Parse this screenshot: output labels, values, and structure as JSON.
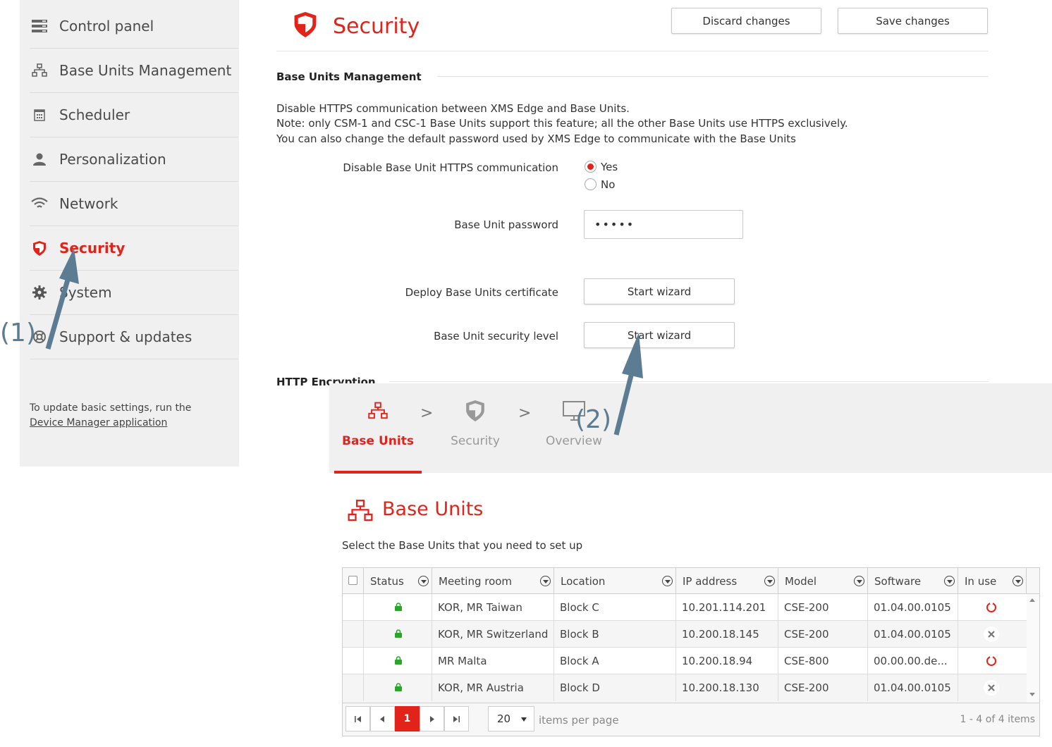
{
  "sidebar": {
    "items": [
      {
        "label": "Control panel",
        "icon": "control-panel-icon"
      },
      {
        "label": "Base Units Management",
        "icon": "network-icon"
      },
      {
        "label": "Scheduler",
        "icon": "calendar-icon"
      },
      {
        "label": "Personalization",
        "icon": "user-icon"
      },
      {
        "label": "Network",
        "icon": "wifi-icon"
      },
      {
        "label": "Security",
        "icon": "shield-icon",
        "active": true
      },
      {
        "label": "System",
        "icon": "gear-icon"
      },
      {
        "label": "Support & updates",
        "icon": "lifebuoy-icon"
      }
    ],
    "note_text": "To update basic settings, run the",
    "note_link": "Device Manager application"
  },
  "header": {
    "title": "Security",
    "discard_label": "Discard changes",
    "save_label": "Save changes"
  },
  "base_units_section": {
    "title": "Base Units Management",
    "desc_lines": [
      "Disable HTTPS communication between XMS Edge and Base Units.",
      "Note: only CSM-1 and CSC-1 Base Units support this feature; all the other Base Units use HTTPS exclusively.",
      "You can also change the default password used by XMS Edge to communicate with the Base Units"
    ],
    "https_label": "Disable Base Unit HTTPS communication",
    "yes_label": "Yes",
    "no_label": "No",
    "password_label": "Base Unit password",
    "password_value": "•••••",
    "deploy_label": "Deploy Base Units certificate",
    "deploy_button": "Start wizard",
    "security_level_label": "Base Unit security level",
    "security_level_button": "Start wizard"
  },
  "http_section": {
    "title": "HTTP Encryption"
  },
  "wizard": {
    "steps": [
      {
        "label": "Base Units",
        "icon": "network-icon",
        "active": true
      },
      {
        "label": "Security",
        "icon": "shield-icon"
      },
      {
        "label": "Overview",
        "icon": "monitor-icon"
      }
    ],
    "step_separator": ">",
    "title": "Base Units",
    "subtitle": "Select the Base Units that you need to set up",
    "columns": [
      "Status",
      "Meeting room",
      "Location",
      "IP address",
      "Model",
      "Software",
      "In use"
    ],
    "rows": [
      {
        "room": "KOR, MR Taiwan",
        "location": "Block C",
        "ip": "10.201.114.201",
        "model": "CSE-200",
        "software": "01.04.00.0105",
        "in_use": "ring"
      },
      {
        "room": "KOR, MR Switzerland",
        "location": "Block B",
        "ip": "10.200.18.145",
        "model": "CSE-200",
        "software": "01.04.00.0105",
        "in_use": "cross"
      },
      {
        "room": "MR Malta",
        "location": "Block A",
        "ip": "10.200.18.94",
        "model": "CSE-800",
        "software": "00.00.00.de...",
        "in_use": "ring"
      },
      {
        "room": "KOR, MR Austria",
        "location": "Block D",
        "ip": "10.200.18.130",
        "model": "CSE-200",
        "software": "01.04.00.0105",
        "in_use": "cross"
      }
    ],
    "pager": {
      "current_page": "1",
      "page_size": "20",
      "items_per_page_label": "items per page",
      "info": "1 - 4 of 4 items"
    }
  },
  "annotations": {
    "label1": "(1)",
    "label2": "(2)"
  },
  "colors": {
    "accent": "#e2231a",
    "annotation": "#5b7c92",
    "status_lock": "#2aa52a"
  }
}
